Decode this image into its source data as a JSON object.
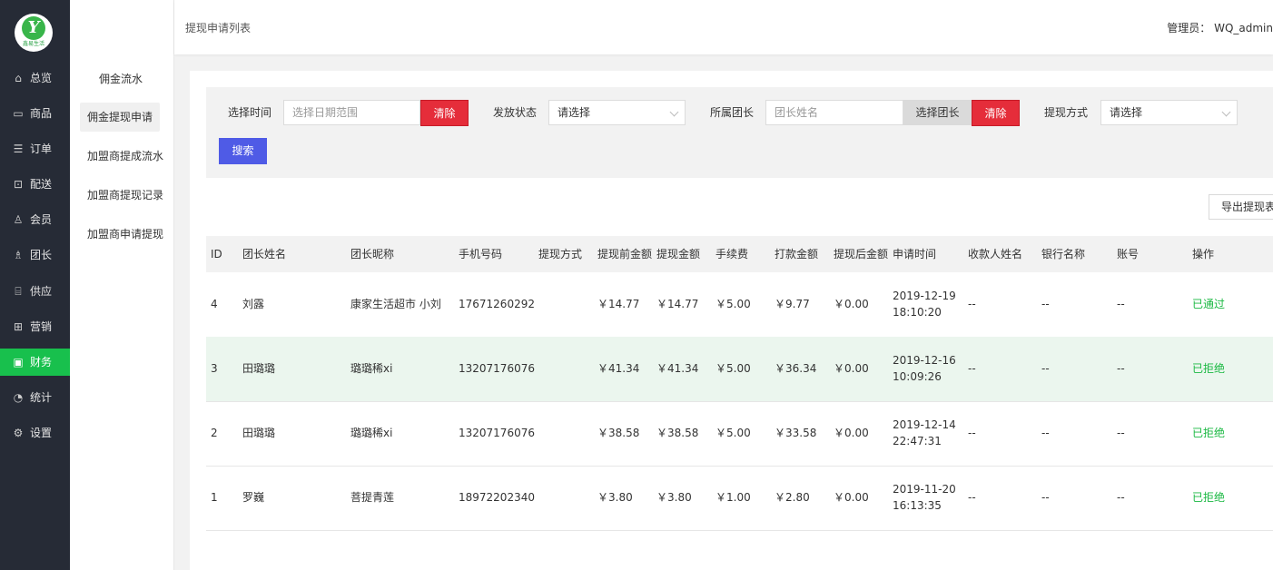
{
  "brand": {
    "logo_letter": "Y",
    "logo_text": "鑫易生活"
  },
  "nav": [
    {
      "label": "总览",
      "icon": "home-icon",
      "glyph": "⌂"
    },
    {
      "label": "商品",
      "icon": "box-icon",
      "glyph": "▭"
    },
    {
      "label": "订单",
      "icon": "order-icon",
      "glyph": "☰"
    },
    {
      "label": "配送",
      "icon": "delivery-icon",
      "glyph": "⊡"
    },
    {
      "label": "会员",
      "icon": "member-icon",
      "glyph": "♙"
    },
    {
      "label": "团长",
      "icon": "leader-icon",
      "glyph": "♗"
    },
    {
      "label": "供应",
      "icon": "supply-icon",
      "glyph": "⌸"
    },
    {
      "label": "营销",
      "icon": "gift-icon",
      "glyph": "⊞"
    },
    {
      "label": "财务",
      "icon": "finance-icon",
      "glyph": "▣"
    },
    {
      "label": "统计",
      "icon": "chart-icon",
      "glyph": "◔"
    },
    {
      "label": "设置",
      "icon": "gear-icon",
      "glyph": "⚙"
    }
  ],
  "subnav": [
    "佣金流水",
    "佣金提现申请",
    "加盟商提成流水",
    "加盟商提现记录",
    "加盟商申请提现"
  ],
  "header": {
    "breadcrumb": "提现申请列表",
    "admin_label": "管理员：",
    "admin_name": "WQ_admin"
  },
  "filter": {
    "time_label": "选择时间",
    "date_placeholder": "选择日期范围",
    "clear_label": "清除",
    "status_label": "发放状态",
    "select_placeholder": "请选择",
    "leader_label": "所属团长",
    "leader_placeholder": "团长姓名",
    "choose_leader_label": "选择团长",
    "method_label": "提现方式",
    "search_label": "搜索"
  },
  "export_label": "导出提现表",
  "table": {
    "headers": [
      "ID",
      "团长姓名",
      "团长昵称",
      "手机号码",
      "提现方式",
      "提现前金额",
      "提现金额",
      "手续费",
      "打款金额",
      "提现后金额",
      "申请时间",
      "收款人姓名",
      "银行名称",
      "账号",
      "操作"
    ],
    "rows": [
      {
        "id": "4",
        "name": "刘露",
        "nick": "康家生活超市 小刘",
        "phone": "17671260292",
        "method": "",
        "before": "￥14.77",
        "amount": "￥14.77",
        "fee": "￥5.00",
        "paid": "￥9.77",
        "after": "￥0.00",
        "date": "2019-12-19",
        "time": "18:10:20",
        "payee": "--",
        "bank": "--",
        "account": "--",
        "status": "已通过"
      },
      {
        "id": "3",
        "name": "田璐璐",
        "nick": "璐璐稀xi",
        "phone": "13207176076",
        "method": "",
        "before": "￥41.34",
        "amount": "￥41.34",
        "fee": "￥5.00",
        "paid": "￥36.34",
        "after": "￥0.00",
        "date": "2019-12-16",
        "time": "10:09:26",
        "payee": "--",
        "bank": "--",
        "account": "--",
        "status": "已拒绝"
      },
      {
        "id": "2",
        "name": "田璐璐",
        "nick": "璐璐稀xi",
        "phone": "13207176076",
        "method": "",
        "before": "￥38.58",
        "amount": "￥38.58",
        "fee": "￥5.00",
        "paid": "￥33.58",
        "after": "￥0.00",
        "date": "2019-12-14",
        "time": "22:47:31",
        "payee": "--",
        "bank": "--",
        "account": "--",
        "status": "已拒绝"
      },
      {
        "id": "1",
        "name": "罗巍",
        "nick": "菩提青莲",
        "phone": "18972202340",
        "method": "",
        "before": "￥3.80",
        "amount": "￥3.80",
        "fee": "￥1.00",
        "paid": "￥2.80",
        "after": "￥0.00",
        "date": "2019-11-20",
        "time": "16:13:35",
        "payee": "--",
        "bank": "--",
        "account": "--",
        "status": "已拒绝"
      }
    ]
  },
  "colors": {
    "sidebar": "#262b36",
    "accent": "#18c04d",
    "danger": "#e52d3a",
    "primary": "#4f5be6",
    "status": "#1ab842"
  }
}
